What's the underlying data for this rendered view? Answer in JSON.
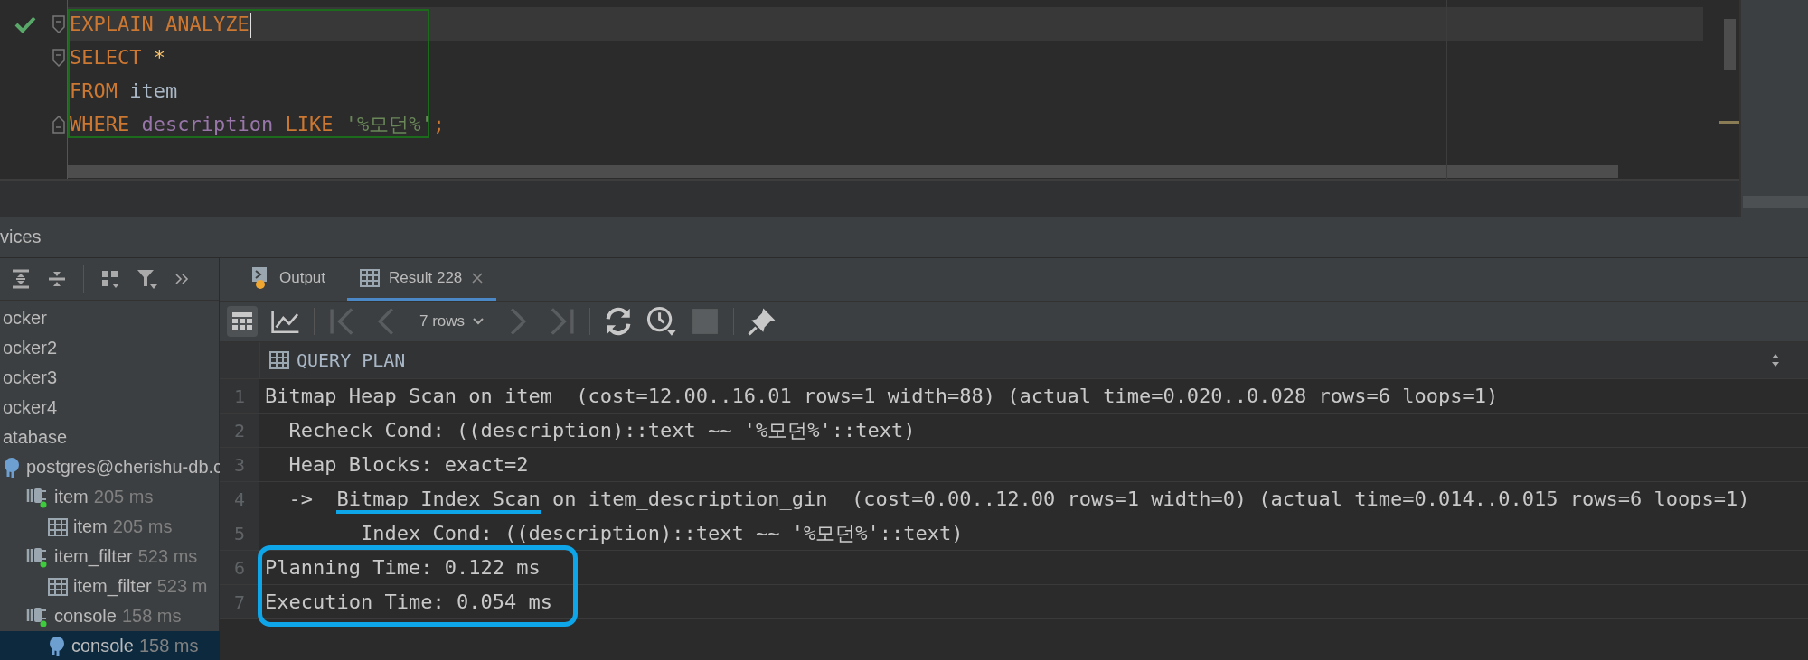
{
  "editor": {
    "statement_selected": true,
    "lines": [
      {
        "executed": true,
        "fold_start": true,
        "fold_end": false,
        "current": true,
        "caret": true,
        "tokens": [
          {
            "text": "EXPLAIN ANALYZE",
            "kind": "keyword"
          }
        ]
      },
      {
        "executed": false,
        "fold_start": true,
        "fold_end": false,
        "current": false,
        "caret": false,
        "tokens": [
          {
            "text": "SELECT",
            "kind": "keyword"
          },
          {
            "text": " *",
            "kind": "star"
          }
        ]
      },
      {
        "executed": false,
        "fold_start": false,
        "fold_end": false,
        "current": false,
        "caret": false,
        "tokens": [
          {
            "text": "FROM",
            "kind": "keyword"
          },
          {
            "text": " item",
            "kind": "table"
          }
        ]
      },
      {
        "executed": false,
        "fold_start": false,
        "fold_end": true,
        "current": false,
        "caret": false,
        "tokens": [
          {
            "text": "WHERE",
            "kind": "keyword"
          },
          {
            "text": " description",
            "kind": "column"
          },
          {
            "text": " LIKE",
            "kind": "keyword"
          },
          {
            "text": " '%모던%'",
            "kind": "string"
          },
          {
            "text": ";",
            "kind": "punct"
          }
        ]
      }
    ]
  },
  "services": {
    "title": "vices",
    "toolbar": [
      {
        "kind": "expand-all"
      },
      {
        "kind": "collapse-all"
      },
      {
        "kind": "sep"
      },
      {
        "kind": "group"
      },
      {
        "kind": "filter"
      },
      {
        "kind": "more"
      }
    ],
    "tree": [
      {
        "label": "ocker",
        "selected": false
      },
      {
        "label": "ocker2",
        "selected": false
      },
      {
        "label": "ocker3",
        "selected": false
      },
      {
        "label": "ocker4",
        "selected": false
      },
      {
        "label": "atabase",
        "selected": false,
        "children": [
          {
            "label": "postgres@cherishu-db.c",
            "kind": "connection",
            "selected": false,
            "children": [
              {
                "label": "item",
                "time": "205 ms",
                "kind": "session",
                "selected": false,
                "children": [
                  {
                    "label": "item",
                    "time": "205 ms",
                    "kind": "table",
                    "selected": false
                  }
                ]
              },
              {
                "label": "item_filter",
                "time": "523 ms",
                "kind": "session",
                "selected": false,
                "children": [
                  {
                    "label": "item_filter",
                    "time": "523 m",
                    "kind": "table",
                    "selected": false
                  }
                ]
              },
              {
                "label": "console",
                "time": "158 ms",
                "kind": "session",
                "selected": false,
                "children": [
                  {
                    "label": "console",
                    "time": "158 ms",
                    "kind": "connection",
                    "selected": true
                  }
                ]
              }
            ]
          }
        ]
      }
    ]
  },
  "results": {
    "tabs": [
      {
        "label": "Output",
        "kind": "output",
        "selected": false,
        "closable": false
      },
      {
        "label": "Result 228",
        "kind": "table",
        "selected": true,
        "closable": true
      }
    ],
    "toolbar": [
      {
        "kind": "table-view",
        "selected": true,
        "disabled": false
      },
      {
        "kind": "chart",
        "selected": false,
        "disabled": false
      },
      {
        "kind": "sep"
      },
      {
        "kind": "first",
        "selected": false,
        "disabled": true
      },
      {
        "kind": "prev",
        "selected": false,
        "disabled": true
      },
      {
        "kind": "rows",
        "label": "7 rows"
      },
      {
        "kind": "next",
        "selected": false,
        "disabled": true
      },
      {
        "kind": "last",
        "selected": false,
        "disabled": true
      },
      {
        "kind": "sep"
      },
      {
        "kind": "refresh",
        "selected": false,
        "disabled": false
      },
      {
        "kind": "history",
        "selected": false,
        "disabled": false
      },
      {
        "kind": "stop",
        "selected": false,
        "disabled": true
      },
      {
        "kind": "sep"
      },
      {
        "kind": "pin",
        "selected": false,
        "disabled": false
      }
    ],
    "column": "QUERY PLAN",
    "rows": [
      {
        "number": "1",
        "boxed": false,
        "parts": [
          {
            "text": "Bitmap Heap Scan on item  (cost=12.00..16.01 rows=1 width=88) (actual time=0.020..0.028 rows=6 loops=1)",
            "underlined": false
          }
        ]
      },
      {
        "number": "2",
        "boxed": false,
        "parts": [
          {
            "text": "  Recheck Cond: ((description)::text ~~ '%모던%'::text)",
            "underlined": false
          }
        ]
      },
      {
        "number": "3",
        "boxed": false,
        "parts": [
          {
            "text": "  Heap Blocks: exact=2",
            "underlined": false
          }
        ]
      },
      {
        "number": "4",
        "boxed": false,
        "parts": [
          {
            "text": "  ->  ",
            "underlined": false
          },
          {
            "text": "Bitmap Index Scan",
            "underlined": true
          },
          {
            "text": " on item_description_gin  (cost=0.00..12.00 rows=1 width=0) (actual time=0.014..0.015 rows=6 loops=1)",
            "underlined": false
          }
        ]
      },
      {
        "number": "5",
        "boxed": false,
        "parts": [
          {
            "text": "        Index Cond: ((description)::text ~~ '%모던%'::text)",
            "underlined": false
          }
        ]
      },
      {
        "number": "6",
        "boxed": true,
        "parts": [
          {
            "text": "Planning Time: 0.122 ms",
            "underlined": false
          }
        ]
      },
      {
        "number": "7",
        "boxed": true,
        "parts": [
          {
            "text": "Execution Time: 0.054 ms",
            "underlined": false
          }
        ]
      }
    ]
  }
}
